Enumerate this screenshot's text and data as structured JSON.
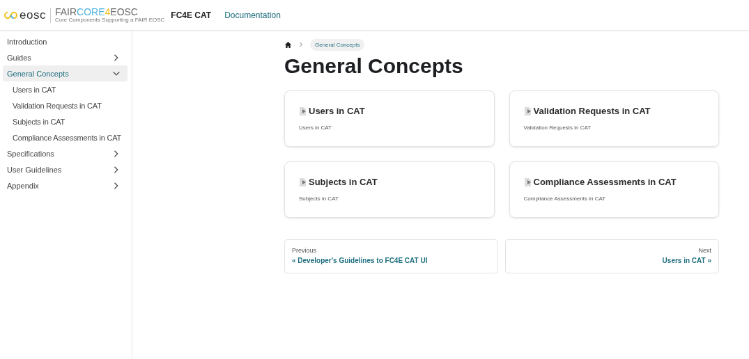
{
  "header": {
    "logo_text": "eosc",
    "brand_parts": [
      {
        "text": "FAIR",
        "color": "#6b6b6b"
      },
      {
        "text": "CORE",
        "color": "#4fb3e0"
      },
      {
        "text": "4",
        "color": "#f2c01e"
      },
      {
        "text": "EOSC",
        "color": "#6b6b6b"
      }
    ],
    "brand_tagline": "Core Components Supporting a FAIR EOSC",
    "site_title": "FC4E CAT",
    "nav": [
      {
        "label": "Documentation"
      }
    ]
  },
  "sidebar": {
    "items": [
      {
        "label": "Introduction",
        "selected": false
      },
      {
        "label": "Guides",
        "has_children": true,
        "expanded": false,
        "selected": false
      },
      {
        "label": "General Concepts",
        "has_children": true,
        "expanded": true,
        "selected": true,
        "children": [
          {
            "label": "Users in CAT",
            "selected": false
          },
          {
            "label": "Validation Requests in CAT",
            "selected": false
          },
          {
            "label": "Subjects in CAT",
            "selected": false
          },
          {
            "label": "Compliance Assessments in CAT",
            "selected": false
          }
        ]
      },
      {
        "label": "Specifications",
        "has_children": true,
        "expanded": false,
        "selected": false
      },
      {
        "label": "User Guidelines",
        "has_children": true,
        "expanded": false,
        "selected": false
      },
      {
        "label": "Appendix",
        "has_children": true,
        "expanded": false,
        "selected": false
      }
    ]
  },
  "breadcrumb": [
    {
      "label": "General Concepts"
    }
  ],
  "title": "General Concepts",
  "cards": [
    {
      "title": "Users in CAT",
      "description": "Users in CAT"
    },
    {
      "title": "Validation Requests in CAT",
      "description": "Validation Requests in CAT"
    },
    {
      "title": "Subjects in CAT",
      "description": "Subjects in CAT"
    },
    {
      "title": "Compliance Assessments in CAT",
      "description": "Compliance Assessments in CAT"
    }
  ],
  "pagination": {
    "previous": {
      "sublabel": "Previous",
      "label": "« Developer's Guidelines to FC4E CAT UI"
    },
    "next": {
      "sublabel": "Next",
      "label": "Users in CAT »"
    }
  }
}
